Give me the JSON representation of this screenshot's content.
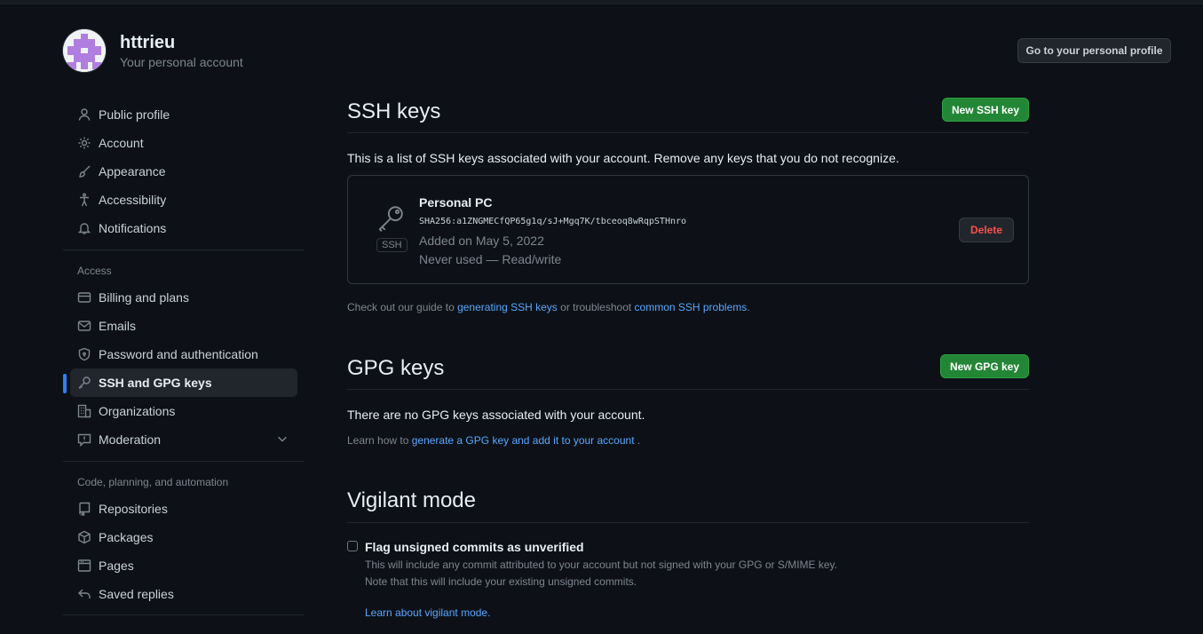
{
  "header": {
    "username": "httrieu",
    "subtitle": "Your personal account",
    "profile_button": "Go to your personal profile"
  },
  "sidebar": {
    "items_top": [
      {
        "label": "Public profile",
        "icon": "person-icon"
      },
      {
        "label": "Account",
        "icon": "gear-icon"
      },
      {
        "label": "Appearance",
        "icon": "paintbrush-icon"
      },
      {
        "label": "Accessibility",
        "icon": "accessibility-icon"
      },
      {
        "label": "Notifications",
        "icon": "bell-icon"
      }
    ],
    "access_heading": "Access",
    "items_access": [
      {
        "label": "Billing and plans",
        "icon": "credit-card-icon"
      },
      {
        "label": "Emails",
        "icon": "mail-icon"
      },
      {
        "label": "Password and authentication",
        "icon": "shield-lock-icon"
      },
      {
        "label": "SSH and GPG keys",
        "icon": "key-icon",
        "active": true
      },
      {
        "label": "Organizations",
        "icon": "organization-icon"
      },
      {
        "label": "Moderation",
        "icon": "report-icon"
      }
    ],
    "code_heading": "Code, planning, and automation",
    "items_code": [
      {
        "label": "Repositories",
        "icon": "repo-icon"
      },
      {
        "label": "Packages",
        "icon": "package-icon"
      },
      {
        "label": "Pages",
        "icon": "browser-icon"
      },
      {
        "label": "Saved replies",
        "icon": "reply-icon"
      }
    ]
  },
  "ssh": {
    "title": "SSH keys",
    "new_button": "New SSH key",
    "description": "This is a list of SSH keys associated with your account. Remove any keys that you do not recognize.",
    "key": {
      "name": "Personal PC",
      "fingerprint": "SHA256:a1ZNGMECfQP65g1q/sJ+Mgq7K/tbceoq8wRqpSTHnro",
      "added": "Added on May 5, 2022",
      "usage": "Never used — Read/write",
      "badge": "SSH",
      "delete_button": "Delete"
    },
    "guide_prefix": "Check out our guide to ",
    "guide_link": "generating SSH keys",
    "guide_middle": " or troubleshoot ",
    "guide_link2": "common SSH problems",
    "guide_suffix": "."
  },
  "gpg": {
    "title": "GPG keys",
    "new_button": "New GPG key",
    "empty_text": "There are no GPG keys associated with your account.",
    "learn_prefix": "Learn how to ",
    "learn_link": "generate a GPG key and add it to your account",
    "learn_suffix": " ."
  },
  "vigilant": {
    "title": "Vigilant mode",
    "checkbox_label": "Flag unsigned commits as unverified",
    "checked": false,
    "desc1": "This will include any commit attributed to your account but not signed with your GPG or S/MIME key.",
    "desc2": "Note that this will include your existing unsigned commits.",
    "learn_link": "Learn about vigilant mode."
  }
}
